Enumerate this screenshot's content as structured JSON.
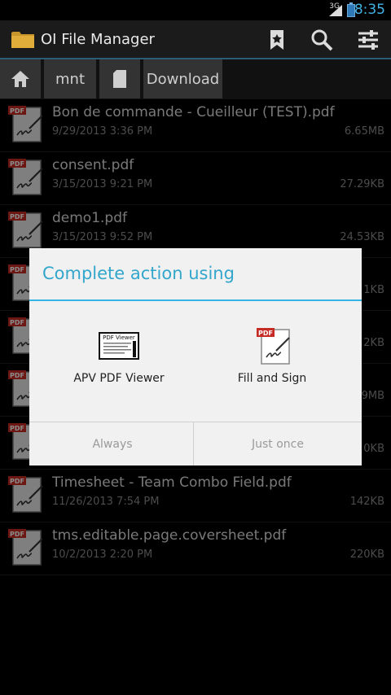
{
  "status": {
    "network": "3G",
    "time": "8:35"
  },
  "actionbar": {
    "title": "OI File Manager",
    "icons": [
      "bookmark-icon",
      "search-icon",
      "settings-sliders-icon"
    ]
  },
  "breadcrumb": {
    "items": [
      "mnt",
      "Download"
    ]
  },
  "files": [
    {
      "name": "Bon de commande - Cueilleur (TEST).pdf",
      "date": "9/29/2013 3:36 PM",
      "size": "6.65MB"
    },
    {
      "name": "consent.pdf",
      "date": "3/15/2013 9:21 PM",
      "size": "27.29KB"
    },
    {
      "name": "demo1.pdf",
      "date": "3/15/2013 9:52 PM",
      "size": "24.53KB"
    },
    {
      "name": "",
      "date": "",
      "size": "1KB"
    },
    {
      "name": "",
      "date": "",
      "size": "2KB"
    },
    {
      "name": "",
      "date": "",
      "size": "9MB"
    },
    {
      "name": "",
      "date": "",
      "size": "0KB"
    },
    {
      "name": "Timesheet - Team Combo Field.pdf",
      "date": "11/26/2013 7:54 PM",
      "size": "142KB"
    },
    {
      "name": "tms.editable.page.coversheet.pdf",
      "date": "10/2/2013 2:20 PM",
      "size": "220KB"
    }
  ],
  "dialog": {
    "title": "Complete action using",
    "apps": [
      {
        "label": "APV PDF Viewer",
        "icon": "pdf-viewer-icon",
        "icon_text": "PDF Viewer"
      },
      {
        "label": "Fill and Sign",
        "icon": "fill-and-sign-icon",
        "icon_text": "PDF"
      }
    ],
    "buttons": {
      "always": "Always",
      "just_once": "Just once"
    }
  },
  "colors": {
    "accent": "#33b5e5",
    "dialog_bg": "#f1f1f1",
    "pdf_red": "#c62b23"
  }
}
